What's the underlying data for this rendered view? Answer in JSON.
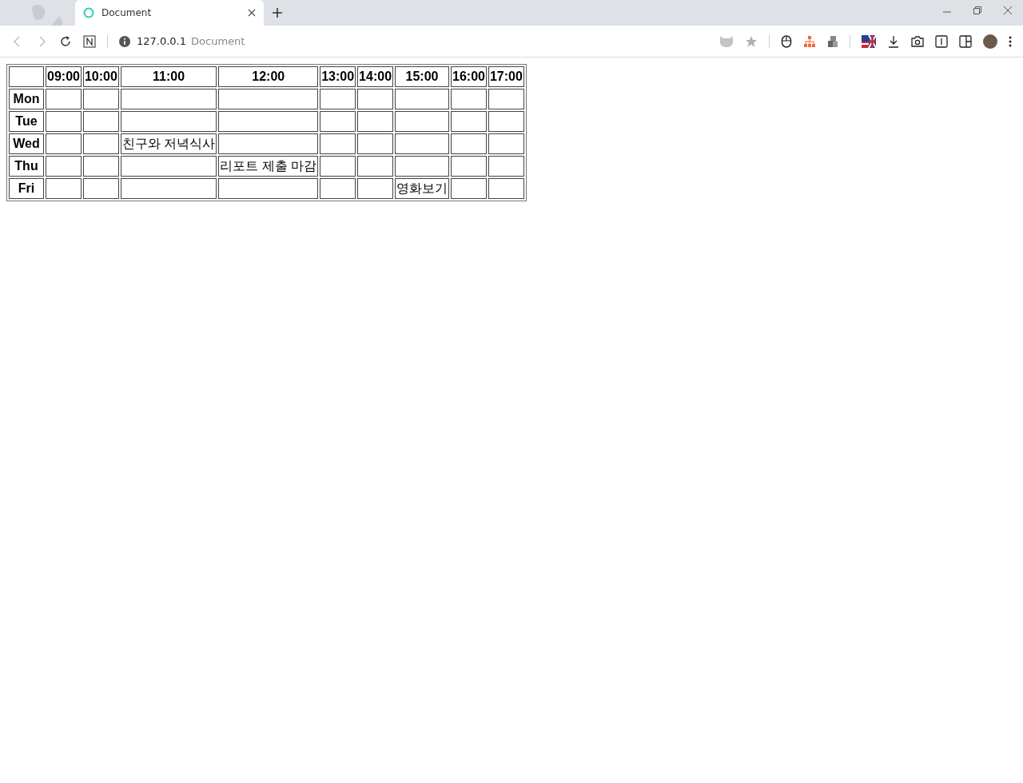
{
  "browser": {
    "tab": {
      "title": "Document",
      "selected": true
    },
    "address": {
      "host": "127.0.0.1",
      "page_title": "Document"
    }
  },
  "table": {
    "columns": [
      "09:00",
      "10:00",
      "11:00",
      "12:00",
      "13:00",
      "14:00",
      "15:00",
      "16:00",
      "17:00"
    ],
    "rows": [
      {
        "day": "Mon",
        "cells": [
          null,
          null,
          null,
          null,
          null,
          null,
          null,
          null,
          null
        ]
      },
      {
        "day": "Tue",
        "cells": [
          null,
          null,
          null,
          null,
          null,
          null,
          null,
          null,
          null
        ]
      },
      {
        "day": "Wed",
        "cells": [
          null,
          null,
          "친구와 저녁식사",
          null,
          null,
          null,
          null,
          null,
          null
        ]
      },
      {
        "day": "Thu",
        "cells": [
          null,
          null,
          null,
          "리포트 제출 마감",
          null,
          null,
          null,
          null,
          null
        ]
      },
      {
        "day": "Fri",
        "cells": [
          null,
          null,
          null,
          null,
          null,
          null,
          "영화보기",
          null,
          null
        ]
      }
    ]
  }
}
